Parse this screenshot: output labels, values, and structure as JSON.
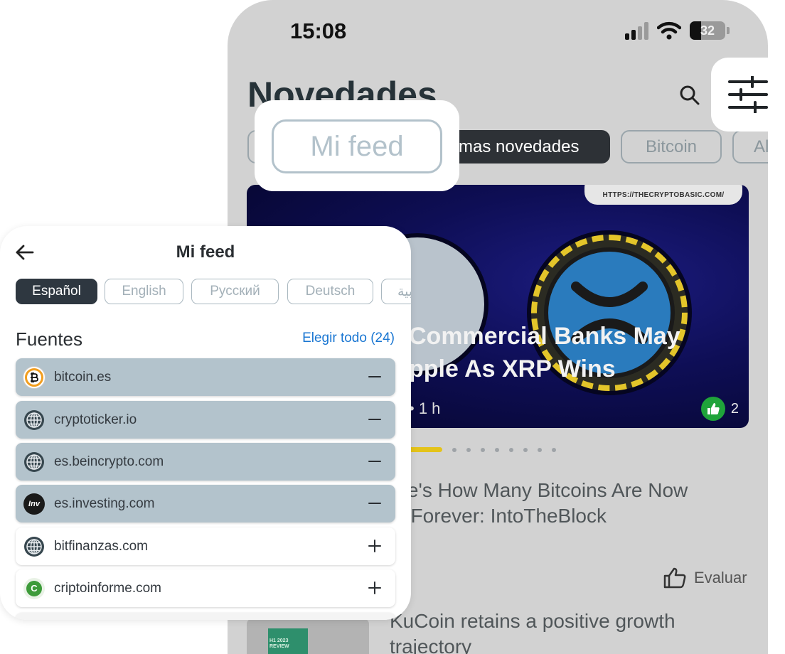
{
  "status_bar": {
    "time": "15:08",
    "battery_percent": "32"
  },
  "feed_screen": {
    "title": "Novedades",
    "chips": [
      {
        "label": ""
      },
      {
        "label": "mas novedades"
      },
      {
        "label": "Bitcoin"
      },
      {
        "label": "Al"
      }
    ],
    "hero": {
      "url": "HTTPS://THECRYPTOBASIC.COM/",
      "title": "Commercial Banks May\npple As XRP Wins",
      "time": "• 1 h",
      "likes": "2"
    },
    "pager": {
      "total_dots": 9,
      "active_index": 0
    },
    "article_title": "ere's How Many Bitcoins Are Now\nst Forever: IntoTheBlock",
    "rate_label": "Evaluar",
    "article2_title": "KuCoin retains a positive growth\ntrajectory",
    "thumbnail_text": "H1 2023 REVIEW"
  },
  "highlight_chip": {
    "label": "Mi feed"
  },
  "mi_feed": {
    "title": "Mi feed",
    "languages": [
      {
        "label": "Español",
        "active": true
      },
      {
        "label": "English",
        "active": false
      },
      {
        "label": "Русский",
        "active": false
      },
      {
        "label": "Deutsch",
        "active": false
      },
      {
        "label": "عربية",
        "active": false
      }
    ],
    "sources_title": "Fuentes",
    "select_all": "Elegir todo (24)",
    "sources": [
      {
        "name": "bitcoin.es",
        "icon": "bitcoin-logo-icon",
        "selected": true
      },
      {
        "name": "cryptoticker.io",
        "icon": "globe-icon",
        "selected": true
      },
      {
        "name": "es.beincrypto.com",
        "icon": "globe-icon",
        "selected": true
      },
      {
        "name": "es.investing.com",
        "icon": "investing-logo-icon",
        "selected": true
      },
      {
        "name": "bitfinanzas.com",
        "icon": "globe-icon",
        "selected": false
      },
      {
        "name": "criptoinforme.com",
        "icon": "criptoinforme-logo-icon",
        "selected": false
      }
    ]
  },
  "colors": {
    "accent_blue": "#1976d2",
    "selected_source_bg": "#b3c3cc",
    "active_chip_bg": "#2d3136",
    "pager_active": "#e4c31a",
    "like_green": "#1fa33a"
  }
}
